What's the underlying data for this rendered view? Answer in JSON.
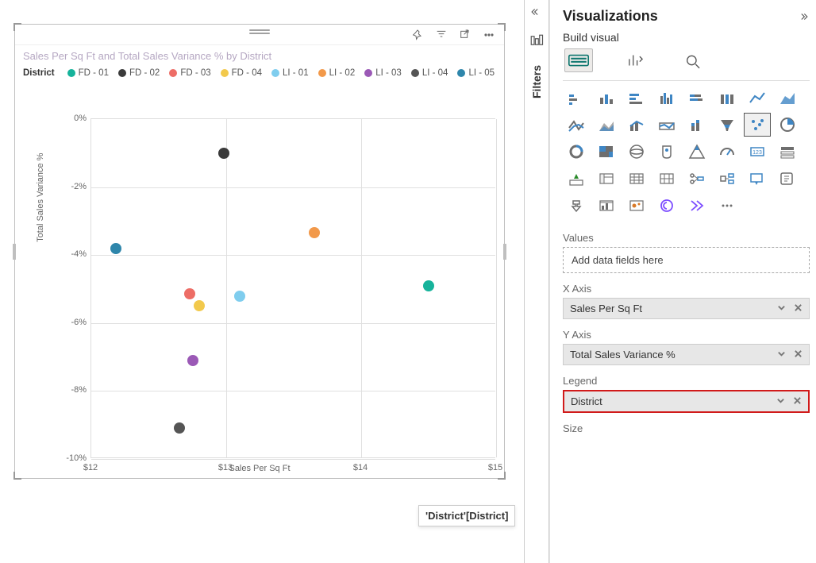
{
  "visual": {
    "title": "Sales Per Sq Ft and Total Sales Variance % by District",
    "header_icons": [
      "pin-icon",
      "filter-icon",
      "focus-icon",
      "more-icon"
    ]
  },
  "chart_data": {
    "type": "scatter",
    "title": "Sales Per Sq Ft and Total Sales Variance % by District",
    "xlabel": "Sales Per Sq Ft",
    "ylabel": "Total Sales Variance %",
    "xlim": [
      12,
      15
    ],
    "ylim": [
      -10,
      0
    ],
    "x_ticks": [
      12,
      13,
      14,
      15
    ],
    "x_tick_labels": [
      "$12",
      "$13",
      "$14",
      "$15"
    ],
    "y_ticks": [
      0,
      -2,
      -4,
      -6,
      -8,
      -10
    ],
    "y_tick_labels": [
      "0%",
      "-2%",
      "-4%",
      "-6%",
      "-8%",
      "-10%"
    ],
    "legend_title": "District",
    "series": [
      {
        "name": "FD - 01",
        "color": "#16b39b",
        "x": 14.5,
        "y": -4.9
      },
      {
        "name": "FD - 02",
        "color": "#3a3a3a",
        "x": 12.98,
        "y": -1.0
      },
      {
        "name": "FD - 03",
        "color": "#ed6d66",
        "x": 12.73,
        "y": -5.15
      },
      {
        "name": "FD - 04",
        "color": "#f2c94c",
        "x": 12.8,
        "y": -5.5
      },
      {
        "name": "LI - 01",
        "color": "#7fcdee",
        "x": 13.1,
        "y": -5.2
      },
      {
        "name": "LI - 02",
        "color": "#f2994a",
        "x": 13.65,
        "y": -3.35
      },
      {
        "name": "LI - 03",
        "color": "#9b59b6",
        "x": 12.75,
        "y": -7.1
      },
      {
        "name": "LI - 04",
        "color": "#555555",
        "x": 12.65,
        "y": -9.1
      },
      {
        "name": "LI - 05",
        "color": "#2e86ab",
        "x": 12.18,
        "y": -3.8
      }
    ]
  },
  "tooltip": "'District'[District]",
  "filters_rail": {
    "label": "Filters"
  },
  "viz_pane": {
    "title": "Visualizations",
    "build_label": "Build visual",
    "tabs": [
      "fields-tab",
      "format-tab",
      "analytics-tab"
    ],
    "field_wells": {
      "values": {
        "label": "Values",
        "placeholder": "Add data fields here"
      },
      "x_axis": {
        "label": "X Axis",
        "item": "Sales Per Sq Ft"
      },
      "y_axis": {
        "label": "Y Axis",
        "item": "Total Sales Variance %"
      },
      "legend": {
        "label": "Legend",
        "item": "District"
      },
      "size": {
        "label": "Size"
      }
    },
    "scatter_label": "Scatter chart"
  }
}
